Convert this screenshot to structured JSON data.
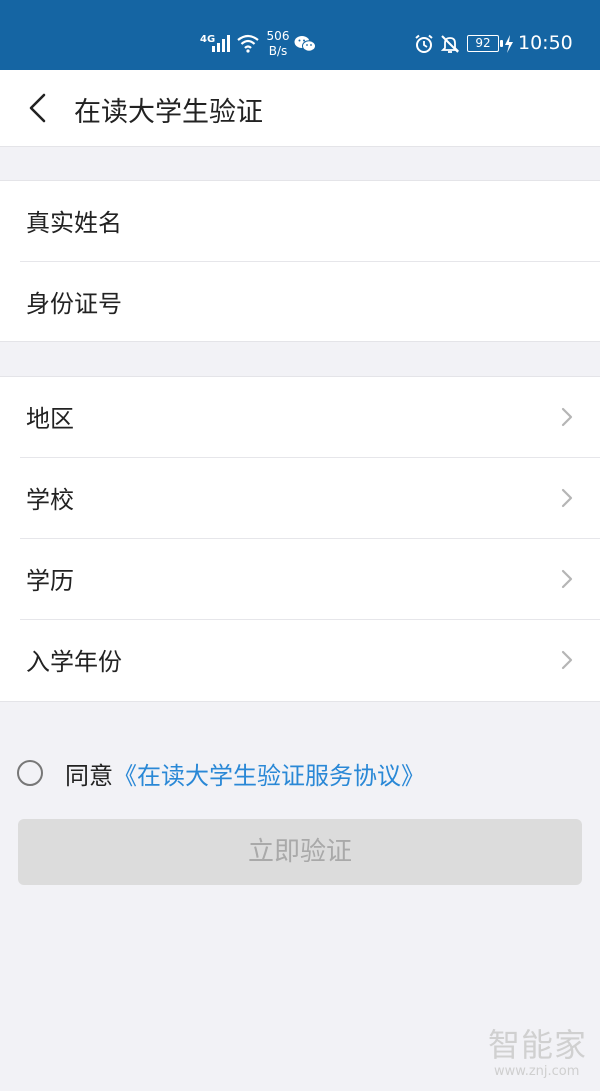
{
  "status_bar": {
    "network": "4G",
    "speed_value": "506",
    "speed_unit": "B/s",
    "battery": "92",
    "time": "10:50"
  },
  "header": {
    "title": "在读大学生验证"
  },
  "form": {
    "identity_rows": [
      {
        "label": "真实姓名"
      },
      {
        "label": "身份证号"
      }
    ],
    "select_rows": [
      {
        "label": "地区"
      },
      {
        "label": "学校"
      },
      {
        "label": "学历"
      },
      {
        "label": "入学年份"
      }
    ]
  },
  "agreement": {
    "prefix": "同意",
    "link_text": "《在读大学生验证服务协议》",
    "checked": false
  },
  "submit": {
    "label": "立即验证"
  },
  "watermark": {
    "main": "智能家",
    "sub": "www.znj.com"
  },
  "colors": {
    "status_bar": "#1565a3",
    "link": "#2a88d6",
    "disabled_button": "#dcdcdc"
  }
}
